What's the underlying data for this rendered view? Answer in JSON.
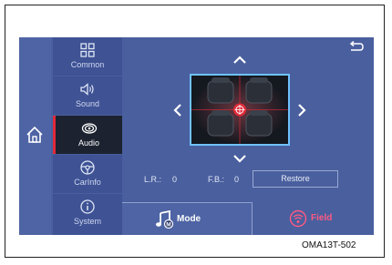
{
  "sidebar": {
    "items": [
      {
        "label": "Common",
        "icon": "grid-icon"
      },
      {
        "label": "Sound",
        "icon": "speaker-icon"
      },
      {
        "label": "Audio",
        "icon": "audio-rings-icon",
        "active": true
      },
      {
        "label": "CarInfo",
        "icon": "steering-wheel-icon"
      },
      {
        "label": "System",
        "icon": "info-icon"
      }
    ]
  },
  "balance": {
    "lr_label": "L.R.:",
    "lr_value": "0",
    "fb_label": "F.B.:",
    "fb_value": "0",
    "restore_label": "Restore"
  },
  "bottom": {
    "mode_label": "Mode",
    "mode_badge": "M",
    "field_label": "Field"
  },
  "caption": "OMA13T-502",
  "colors": {
    "screen_bg": "#4a5f9e",
    "active_bg": "#1c2230",
    "active_accent": "#e02a3a",
    "field_accent": "#ff5a82",
    "seat_border": "#6fc2ff"
  }
}
